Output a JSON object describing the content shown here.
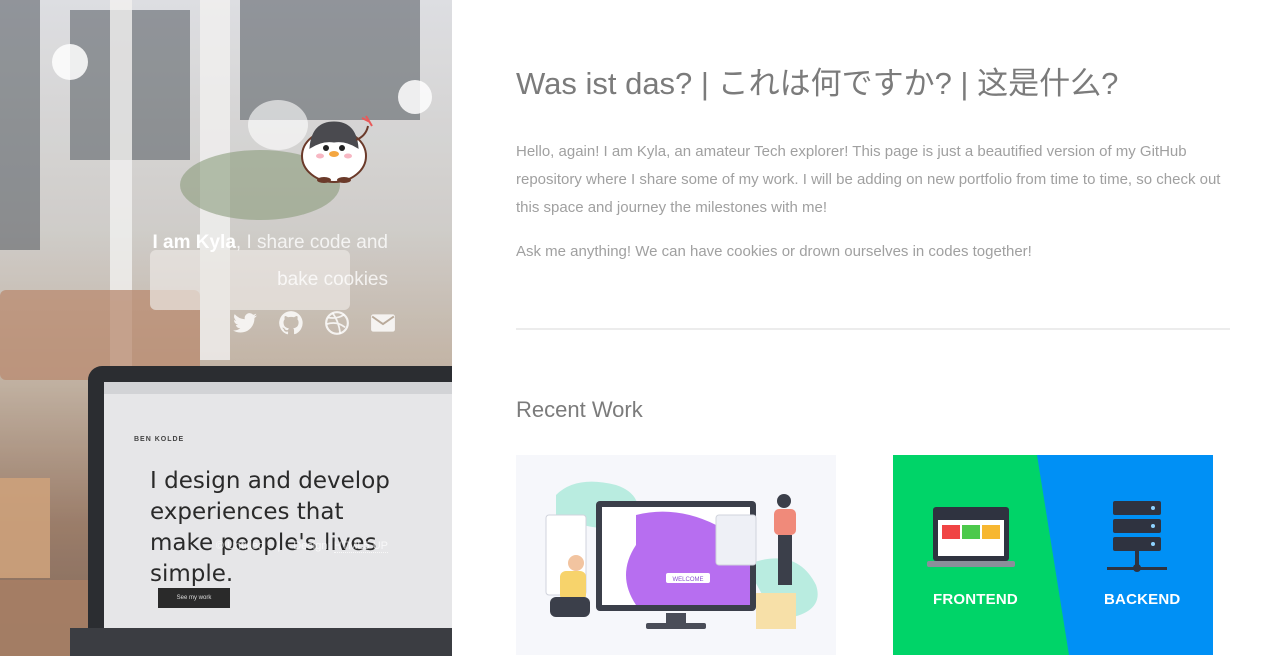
{
  "sidebar": {
    "tagline": {
      "name": "I am Kyla",
      "rest": ", I share code and bake cookies"
    },
    "social": [
      {
        "icon": "twitter-icon"
      },
      {
        "icon": "github-icon"
      },
      {
        "icon": "dribbble-icon"
      },
      {
        "icon": "envelope-icon"
      }
    ],
    "footer": {
      "copyright": "© Untitled",
      "separator": "|",
      "design_prefix": "Design: ",
      "design_link": "HTML5 UP"
    },
    "laptop_screen": {
      "logo": "BEN KOLDE",
      "headline": "I design and develop experiences that make people's lives simple.",
      "button": "See my work"
    }
  },
  "main": {
    "title": "Was ist das? | これは何ですか? | 这是什么?",
    "intro": "Hello, again! I am Kyla, an amateur Tech explorer! This page is just a beautified version of my GitHub repository where I share some of my work. I will be adding on new portfolio from time to time, so check out this space and journey the milestones with me!",
    "ask": "Ask me anything! We can have cookies or drown ourselves in codes together!",
    "recent_work": {
      "title": "Recent Work",
      "items": [
        {
          "label": "WELCOME"
        },
        {
          "label_left": "FRONTEND",
          "label_right": "BACKEND"
        }
      ]
    }
  },
  "colors": {
    "frontend_green": "#00d468",
    "backend_blue": "#0090f5",
    "body_text": "#a0a0a0",
    "heading": "#7b7b7b"
  }
}
